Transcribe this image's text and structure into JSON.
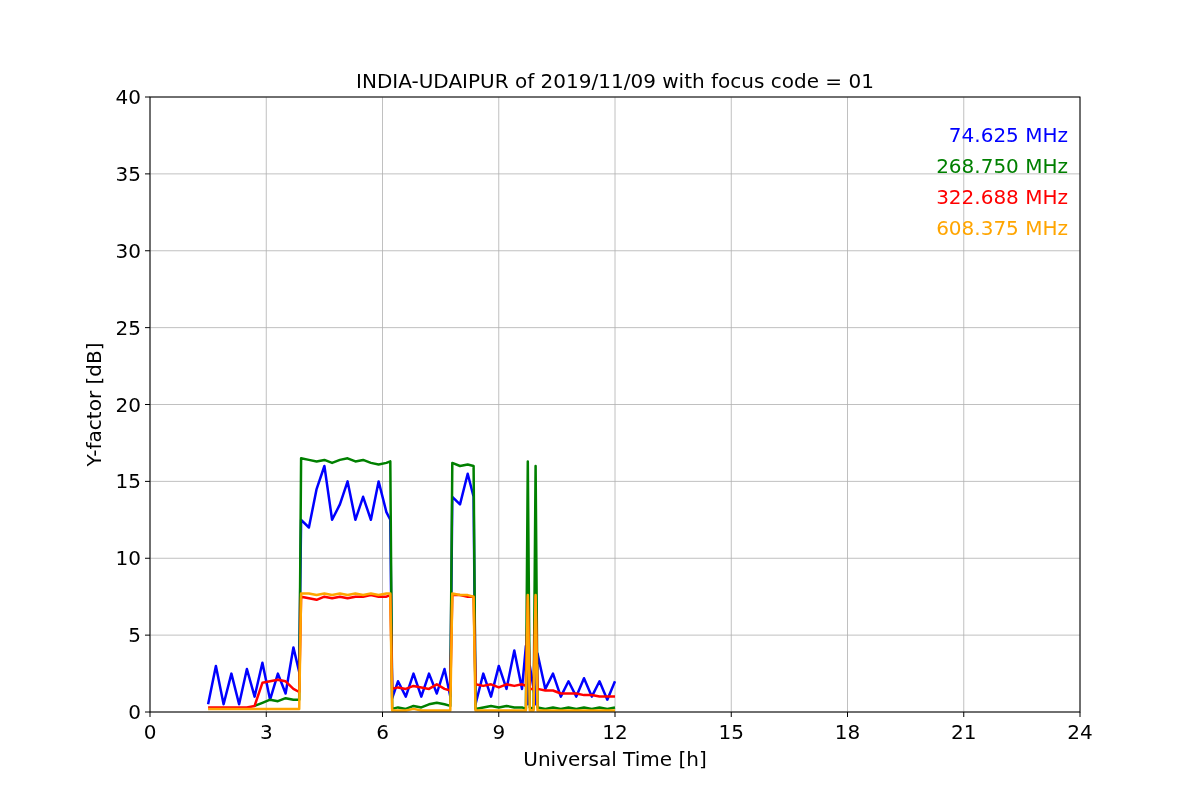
{
  "figure": {
    "chart_data": {
      "type": "line",
      "title": "INDIA-UDAIPUR of 2019/11/09 with focus code = 01",
      "xlabel": "Universal Time [h]",
      "ylabel": "Y-factor [dB]",
      "grid": true,
      "xlim": [
        0,
        24
      ],
      "ylim": [
        0,
        40
      ],
      "xticks": [
        0,
        3,
        6,
        9,
        12,
        15,
        18,
        21,
        24
      ],
      "yticks": [
        0,
        5,
        10,
        15,
        20,
        25,
        30,
        35,
        40
      ],
      "x": [
        1.5,
        1.7,
        1.9,
        2.1,
        2.3,
        2.5,
        2.7,
        2.9,
        3.1,
        3.3,
        3.5,
        3.7,
        3.85,
        3.9,
        4.1,
        4.3,
        4.5,
        4.7,
        4.9,
        5.1,
        5.3,
        5.5,
        5.7,
        5.9,
        6.1,
        6.2,
        6.25,
        6.4,
        6.6,
        6.8,
        7.0,
        7.2,
        7.4,
        7.6,
        7.75,
        7.8,
        8.0,
        8.2,
        8.35,
        8.4,
        8.6,
        8.8,
        9.0,
        9.2,
        9.4,
        9.6,
        9.7,
        9.75,
        9.8,
        9.9,
        9.95,
        10.0,
        10.2,
        10.4,
        10.6,
        10.8,
        11.0,
        11.2,
        11.4,
        11.6,
        11.8,
        12.0
      ],
      "series": [
        {
          "name": "74.625 MHz",
          "color": "#0000ff",
          "values": [
            0.5,
            3.0,
            0.5,
            2.5,
            0.5,
            2.8,
            1.0,
            3.2,
            0.8,
            2.5,
            1.2,
            4.2,
            2.6,
            12.5,
            12.0,
            14.5,
            16.0,
            12.5,
            13.5,
            15.0,
            12.5,
            14.0,
            12.5,
            15.0,
            13.0,
            12.5,
            0.9,
            2.0,
            1.0,
            2.5,
            1.0,
            2.5,
            1.2,
            2.8,
            1.0,
            14.0,
            13.5,
            15.5,
            14.0,
            0.5,
            2.5,
            1.0,
            3.0,
            1.5,
            4.0,
            1.5,
            4.3,
            0.5,
            3.0,
            1.5,
            0.5,
            3.8,
            1.5,
            2.5,
            1.0,
            2.0,
            1.0,
            2.2,
            1.0,
            2.0,
            0.8,
            2.0
          ]
        },
        {
          "name": "268.750 MHz",
          "color": "#008000",
          "values": [
            null,
            null,
            null,
            null,
            null,
            null,
            0.4,
            0.6,
            0.8,
            0.7,
            0.9,
            0.8,
            0.8,
            16.5,
            16.4,
            16.3,
            16.4,
            16.2,
            16.4,
            16.5,
            16.3,
            16.4,
            16.2,
            16.1,
            16.2,
            16.3,
            0.2,
            0.3,
            0.2,
            0.4,
            0.3,
            0.5,
            0.6,
            0.5,
            0.4,
            16.2,
            16.0,
            16.1,
            16.0,
            0.2,
            0.3,
            0.4,
            0.3,
            0.4,
            0.3,
            0.3,
            0.2,
            16.3,
            0.3,
            0.2,
            16.0,
            0.3,
            0.2,
            0.3,
            0.2,
            0.3,
            0.2,
            0.3,
            0.2,
            0.3,
            0.2,
            0.3
          ]
        },
        {
          "name": "322.688 MHz",
          "color": "#ff0000",
          "values": [
            0.3,
            0.3,
            0.3,
            0.3,
            0.3,
            0.3,
            0.4,
            1.9,
            2.0,
            2.1,
            2.0,
            1.5,
            1.3,
            7.5,
            7.4,
            7.3,
            7.5,
            7.4,
            7.5,
            7.4,
            7.5,
            7.5,
            7.6,
            7.5,
            7.5,
            7.6,
            1.5,
            1.6,
            1.5,
            1.7,
            1.6,
            1.5,
            1.8,
            1.5,
            1.4,
            7.6,
            7.6,
            7.5,
            7.5,
            1.8,
            1.7,
            1.8,
            1.6,
            1.8,
            1.7,
            1.8,
            1.7,
            7.5,
            1.5,
            1.5,
            7.5,
            1.5,
            1.4,
            1.4,
            1.2,
            1.2,
            1.2,
            1.1,
            1.1,
            1.0,
            1.0,
            1.0
          ]
        },
        {
          "name": "608.375 MHz",
          "color": "#ffa500",
          "values": [
            0.2,
            0.2,
            0.2,
            0.2,
            0.2,
            0.2,
            0.2,
            0.2,
            0.2,
            0.2,
            0.2,
            0.2,
            0.2,
            7.7,
            7.7,
            7.6,
            7.7,
            7.6,
            7.7,
            7.6,
            7.7,
            7.6,
            7.7,
            7.6,
            7.7,
            7.7,
            0.1,
            0.1,
            0.1,
            0.2,
            0.1,
            0.1,
            0.1,
            0.1,
            0.1,
            7.7,
            7.6,
            7.6,
            7.5,
            0.1,
            0.1,
            0.1,
            0.1,
            0.1,
            0.1,
            0.1,
            0.1,
            7.6,
            0.1,
            0.1,
            7.6,
            0.1,
            0.1,
            0.1,
            0.1,
            0.1,
            0.1,
            0.1,
            0.1,
            0.1,
            0.1,
            0.1
          ]
        }
      ]
    }
  }
}
